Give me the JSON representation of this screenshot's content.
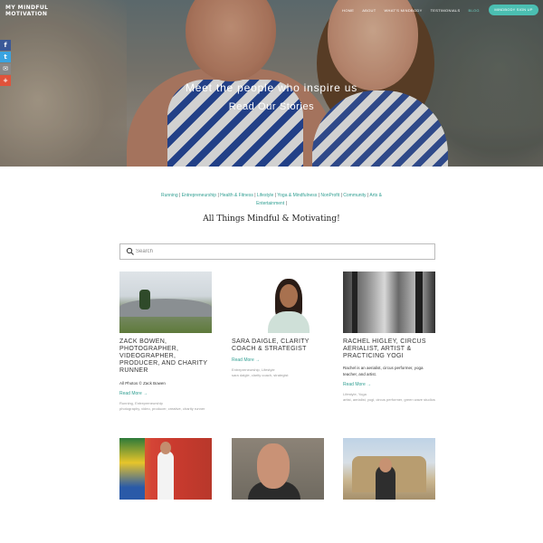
{
  "header": {
    "logo_line1": "MY MINDFUL",
    "logo_line2": "MOTIVATION",
    "nav": [
      "HOME",
      "ABOUT",
      "WHAT'S MINDBODY",
      "TESTIMONIALS",
      "BLOG"
    ],
    "active_nav": "BLOG",
    "signup_label": "MINDBODY SIGN UP"
  },
  "hero": {
    "title": "Meet the people who inspire us",
    "subtitle": "Read Our Stories"
  },
  "social": [
    "f",
    "t",
    "✉",
    "+"
  ],
  "categories": {
    "items": [
      "Running",
      "Entrepreneurship",
      "Health & Fitness",
      "Lifestyle",
      "Yoga & Mindfulness",
      "NonProfit",
      "Community",
      "Arts & Entertainment"
    ],
    "separator": " | "
  },
  "main_title": "All Things Mindful & Motivating!",
  "search": {
    "placeholder": "Search",
    "value": ""
  },
  "cards": [
    {
      "title": "ZACK BOWEN, PHOTOGRAPHER, VIDEOGRAPHER, PRODUCER, AND CHARITY RUNNER",
      "desc": "All Photos © Zack Bowen",
      "read_more": "Read More →",
      "category": "Running, Entrepreneurship",
      "tags": "photography, video, producer, creative, charity runner"
    },
    {
      "title": "SARA DAIGLE, CLARITY COACH & STRATEGIST",
      "desc": "",
      "read_more": "Read More →",
      "category": "Entrepreneurship, Lifestyle",
      "tags": "sara daigle, clarity coach, strategist"
    },
    {
      "title": "RACHEL HIGLEY, CIRCUS AERIALIST, ARTIST & PRACTICING YOGI",
      "desc": "Rachel is an aerialist, circus performer, yoga teacher, and artist.",
      "read_more": "Read More →",
      "category": "Lifestyle, Yoga",
      "tags": "artist, aerialist, yogi, circus performer, green wave studios"
    }
  ]
}
